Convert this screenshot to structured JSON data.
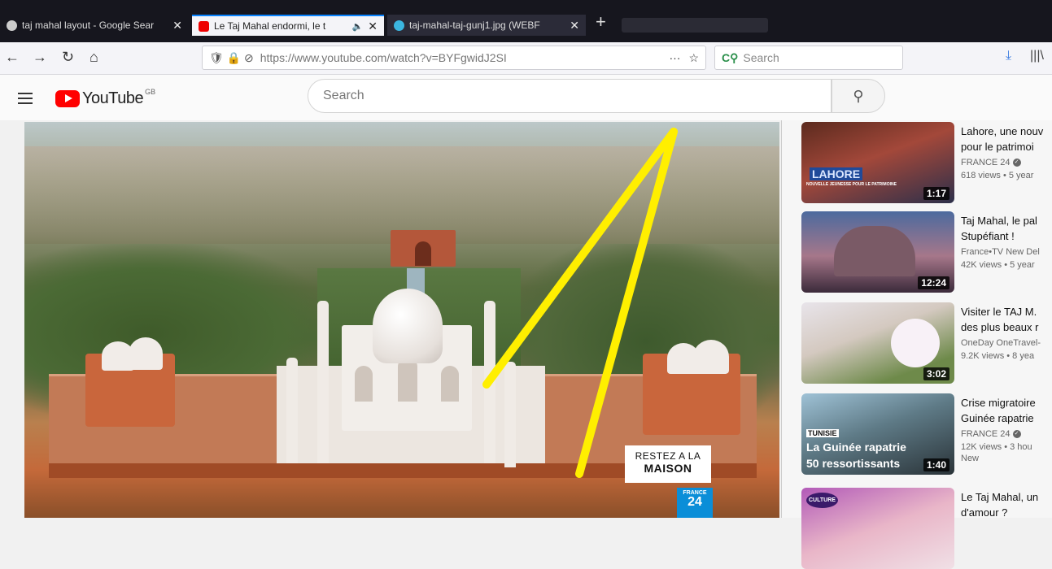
{
  "browser": {
    "tabs": [
      {
        "title": "taj mahal layout - Google Sear",
        "close": "✕"
      },
      {
        "title": "Le Taj Mahal endormi, le t",
        "close": "✕",
        "audio": "🔈"
      },
      {
        "title": "taj-mahal-taj-gunj1.jpg (WEBF",
        "close": "✕"
      }
    ],
    "new_tab": "+",
    "nav": {
      "back": "←",
      "forward": "→",
      "reload": "↻",
      "home": "⌂"
    },
    "url": "https://www.youtube.com/watch?v=BYFgwidJ2SI",
    "url_prefix": "🛡 🔒 ⊘",
    "url_more": "···",
    "bookmark_icon": "☆",
    "search_placeholder": "Search",
    "search_engine_icon": "C⚲",
    "right_icons": {
      "download": "⤓",
      "library": "|||\\"
    }
  },
  "youtube": {
    "logo_text": "YouTube",
    "country": "GB",
    "search_placeholder": "Search",
    "search_icon": "⚲"
  },
  "player": {
    "caption_line1": "RESTEZ A LA",
    "caption_line2": "MAISON",
    "channel_logo_top": "FRANCE",
    "channel_logo_num": "24",
    "annotation_color": "#ffef00"
  },
  "sidebar": {
    "videos": [
      {
        "title1": "Lahore, une nouv",
        "title2": "pour le patrimoi",
        "channel": "FRANCE 24",
        "verified": "✓",
        "meta": "618 views • 5 year",
        "duration": "1:17",
        "thumb_text": "LAHORE",
        "thumb_sub": "NOUVELLE JEUNESSE POUR LE PATRIMOINE"
      },
      {
        "title1": "Taj Mahal, le pal",
        "title2": "Stupéfiant !",
        "channel": "France•TV New Del",
        "meta": "42K views • 5 year",
        "duration": "12:24",
        "thumb_text": ""
      },
      {
        "title1": "Visiter le TAJ M.",
        "title2": "des plus beaux r",
        "channel": "OneDay OneTravel-",
        "meta": "9.2K views • 8 yea",
        "duration": "3:02",
        "thumb_text": ""
      },
      {
        "title1": "Crise migratoire",
        "title2": "Guinée rapatrie",
        "channel": "FRANCE 24",
        "verified": "✓",
        "meta": "12K views • 3 hou",
        "badge": "New",
        "duration": "1:40",
        "thumb_text": "La Guinée rapatrie",
        "thumb_sub": "50 ressortissants",
        "thumb_tag": "TUNISIE"
      },
      {
        "title1": "Le Taj Mahal, un",
        "title2": "d'amour ?",
        "channel": "",
        "meta": "",
        "duration": "",
        "thumb_text": "CULTURE"
      }
    ]
  }
}
